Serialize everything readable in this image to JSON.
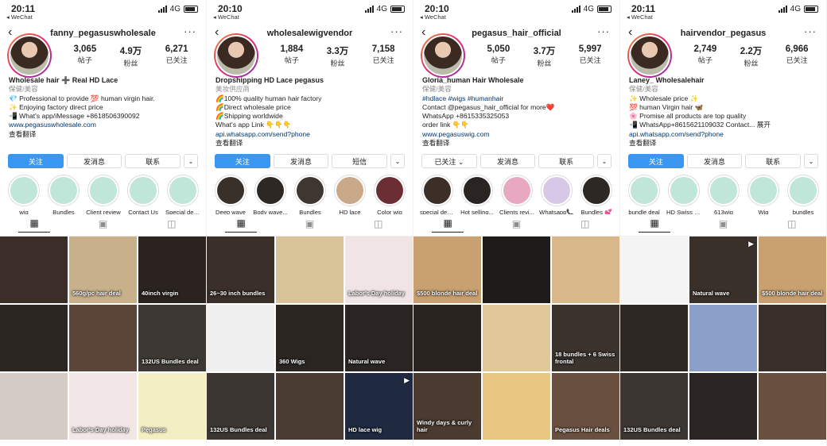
{
  "screens": [
    {
      "status": {
        "time": "20:11",
        "app": "◂ WeChat",
        "network": "4G"
      },
      "nav": {
        "title": "fanny_pegasuswholesale",
        "back": "‹",
        "more": "···"
      },
      "stats": [
        {
          "num": "3,065",
          "lbl": "帖子"
        },
        {
          "num": "4.9万",
          "lbl": "粉丝"
        },
        {
          "num": "6,271",
          "lbl": "已关注"
        }
      ],
      "bio": {
        "name": "Wholesale hair ➕ Real HD Lace",
        "category": "保健/美容",
        "lines": [
          "💎 Professional to provide 💯 human virgin hair.",
          "✨ Enjoying factory direct price",
          "📲 What's app/iMessage +8618506390092"
        ],
        "link": "www.pegasuswholesale.com",
        "translate": "查看翻译"
      },
      "buttons": [
        "关注",
        "发消息",
        "联系",
        "⌄"
      ],
      "highlights": [
        {
          "label": "wig",
          "color": "#bfe6d9"
        },
        {
          "label": "Bundles",
          "color": "#bfe6d9"
        },
        {
          "label": "Client review",
          "color": "#bfe6d9"
        },
        {
          "label": "Contact Us",
          "color": "#bfe6d9"
        },
        {
          "label": "Special deals",
          "color": "#bfe6d9"
        }
      ],
      "posts": [
        {
          "caption": "",
          "color": "#3b2e28",
          "video": false
        },
        {
          "caption": "560g/pc hair deal",
          "color": "#c8b08a",
          "video": false
        },
        {
          "caption": "40inch virgin",
          "color": "#2a2320",
          "video": false
        },
        {
          "caption": "",
          "color": "#2c2622",
          "video": false
        },
        {
          "caption": "",
          "color": "#5a4538",
          "video": false
        },
        {
          "caption": "132US Bundles deal",
          "color": "#3d3833",
          "video": false
        },
        {
          "caption": "",
          "color": "#d4ccc4",
          "video": false
        },
        {
          "caption": "Labor's Day holiday",
          "color": "#f2e6e6",
          "video": false
        },
        {
          "caption": "Pegasus",
          "color": "#f4eec4",
          "video": false
        }
      ]
    },
    {
      "status": {
        "time": "20:10",
        "app": "◂ WeChat",
        "network": "4G"
      },
      "nav": {
        "title": "wholesalewigvendor",
        "back": "‹",
        "more": "···"
      },
      "stats": [
        {
          "num": "1,884",
          "lbl": "帖子"
        },
        {
          "num": "3.3万",
          "lbl": "粉丝"
        },
        {
          "num": "7,158",
          "lbl": "已关注"
        }
      ],
      "bio": {
        "name": "Dropshipping HD Lace pegasus",
        "category": "美妆供应商",
        "lines": [
          "🌈100% quality human hair factory",
          "🌈Direct wholesale price",
          "🌈Shipping worldwide",
          "What's app Link 👇👇👇"
        ],
        "link": "api.whatsapp.com/send?phone",
        "translate": "查看翻译"
      },
      "buttons": [
        "关注",
        "发消息",
        "短信",
        "⌄"
      ],
      "highlights": [
        {
          "label": "Deep wave",
          "color": "#3a302a"
        },
        {
          "label": "Body wave...",
          "color": "#2e2824"
        },
        {
          "label": "Bundles",
          "color": "#403630"
        },
        {
          "label": "HD lace",
          "color": "#c9a987"
        },
        {
          "label": "Color wig",
          "color": "#6a2e34"
        }
      ],
      "posts": [
        {
          "caption": "26~30 inch bundles",
          "color": "#3a2f29",
          "video": false
        },
        {
          "caption": "",
          "color": "#d9c49a",
          "video": false
        },
        {
          "caption": "Labor's Day holiday",
          "color": "#f0e4e4",
          "video": false
        },
        {
          "caption": "",
          "color": "#f0f0f0",
          "video": false
        },
        {
          "caption": "360 Wigs",
          "color": "#2b2522",
          "video": false
        },
        {
          "caption": "Natural wave",
          "color": "#2a2522",
          "video": false
        },
        {
          "caption": "132US Bundles deal",
          "color": "#3b3632",
          "video": false
        },
        {
          "caption": "",
          "color": "#4a3c33",
          "video": false
        },
        {
          "caption": "HD lace wig",
          "color": "#1f2a40",
          "video": true
        }
      ]
    },
    {
      "status": {
        "time": "20:10",
        "app": "◂ WeChat",
        "network": "4G"
      },
      "nav": {
        "title": "pegasus_hair_official",
        "back": "‹",
        "more": "···"
      },
      "stats": [
        {
          "num": "5,050",
          "lbl": "帖子"
        },
        {
          "num": "3.7万",
          "lbl": "粉丝"
        },
        {
          "num": "5,997",
          "lbl": "已关注"
        }
      ],
      "bio": {
        "name": "Gloria_human Hair Wholesale",
        "category": "保健/美容",
        "lines": [
          "#hdlace #wigs #humanhair",
          "Contact @pegasus_hair_official for more❤️",
          "WhatsApp +8615335325053",
          "order link 👇👇"
        ],
        "link": "www.pegasuswig.com",
        "translate": "查看翻译"
      },
      "buttons": [
        "已关注 ⌄",
        "发消息",
        "联系",
        "⌄"
      ],
      "highlights": [
        {
          "label": "special deal...",
          "color": "#3b2f28"
        },
        {
          "label": "Hot selling...",
          "color": "#2a2522"
        },
        {
          "label": "Clients revi...",
          "color": "#e8a8c0"
        },
        {
          "label": "Whatsapp📞",
          "color": "#d8c8e8"
        },
        {
          "label": "Bundles 💕",
          "color": "#2e2824"
        }
      ],
      "posts": [
        {
          "caption": "$500 blonde hair deal",
          "color": "#c9a070",
          "video": false
        },
        {
          "caption": "",
          "color": "#1f1b19",
          "video": false
        },
        {
          "caption": "",
          "color": "#d8b888",
          "video": false
        },
        {
          "caption": "",
          "color": "#2a2420",
          "video": false
        },
        {
          "caption": "",
          "color": "#e0c89a",
          "video": false
        },
        {
          "caption": "18 bundles + 6 Swiss frontal",
          "color": "#3a332e",
          "video": false
        },
        {
          "caption": "Windy days & curly hair",
          "color": "#4a3a30",
          "video": false
        },
        {
          "caption": "",
          "color": "#e8c880",
          "video": false
        },
        {
          "caption": "Pegasus Hair deals",
          "color": "#6a5040",
          "video": false
        }
      ]
    },
    {
      "status": {
        "time": "20:11",
        "app": "◂ WeChat",
        "network": "4G"
      },
      "nav": {
        "title": "hairvendor_pegasus",
        "back": "‹",
        "more": "···"
      },
      "stats": [
        {
          "num": "2,749",
          "lbl": "帖子"
        },
        {
          "num": "2.2万",
          "lbl": "粉丝"
        },
        {
          "num": "6,966",
          "lbl": "已关注"
        }
      ],
      "bio": {
        "name": "Laney_ Wholesalehair",
        "category": "保健/美容",
        "lines": [
          "✨ Wholesale price ✨",
          "💯 human Virgin hair 🦋",
          "🌸 Promise all products are top quality",
          "📲 WhatsApp+8615621109032 Contact... 展开"
        ],
        "link": "api.whatsapp.com/send?phone",
        "translate": "查看翻译"
      },
      "buttons": [
        "关注",
        "发消息",
        "联系",
        "⌄"
      ],
      "highlights": [
        {
          "label": "bundle deal",
          "color": "#bfe6d9"
        },
        {
          "label": "HD Swiss L...",
          "color": "#bfe6d9"
        },
        {
          "label": "613wig",
          "color": "#bfe6d9"
        },
        {
          "label": "Wig",
          "color": "#bfe6d9"
        },
        {
          "label": "bundles",
          "color": "#bfe6d9"
        }
      ],
      "posts": [
        {
          "caption": "",
          "color": "#f4f4f4",
          "video": false
        },
        {
          "caption": "Natural wave",
          "color": "#3a302a",
          "video": true
        },
        {
          "caption": "$500 blonde hair deal",
          "color": "#c9a070",
          "video": false
        },
        {
          "caption": "",
          "color": "#2e2824",
          "video": false
        },
        {
          "caption": "",
          "color": "#8aa0c8",
          "video": false
        },
        {
          "caption": "",
          "color": "#3a2e28",
          "video": false
        },
        {
          "caption": "132US Bundles deal",
          "color": "#3b3632",
          "video": false
        },
        {
          "caption": "",
          "color": "#2a2522",
          "video": false
        },
        {
          "caption": "",
          "color": "#6a5040",
          "video": false
        }
      ]
    }
  ]
}
